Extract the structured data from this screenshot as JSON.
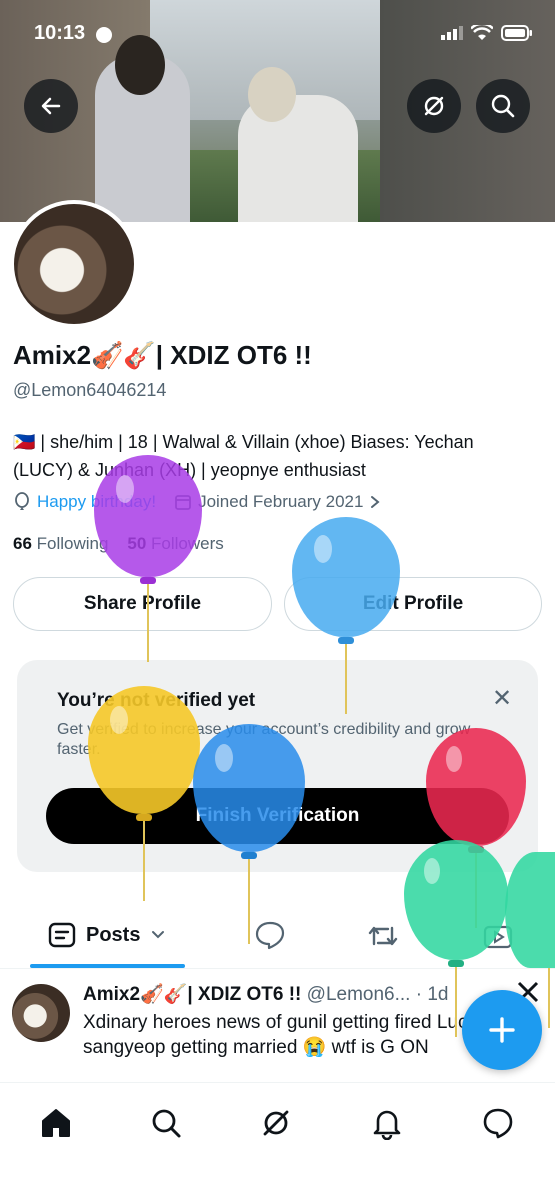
{
  "status": {
    "time": "10:13"
  },
  "profile": {
    "name": "Amix2🎻🎸| XDIZ OT6 !!",
    "handle": "@Lemon64046214",
    "bio": "🇵🇭 | she/him | 18 | Walwal & Villain (xhoe) Biases: Yechan (LUCY) & Junhan (XH) | yeopnye enthusiast",
    "birthday_label": "Happy birthday!",
    "joined": "Joined February 2021",
    "following_count": "66",
    "following_label": "Following",
    "followers_count": "50",
    "followers_label": "Followers"
  },
  "buttons": {
    "share": "Share Profile",
    "edit": "Edit Profile"
  },
  "verify": {
    "title": "You’re not verified yet",
    "subtitle": "Get verified to increase your account’s credibility and grow faster.",
    "button": "Finish Verification"
  },
  "tabs": {
    "posts": "Posts"
  },
  "tweet": {
    "name": "Amix2🎻🎸| XDIZ OT6 !!",
    "handle_time": "@Lemon6... · 1d",
    "body": "Xdinary heroes news of gunil getting fired Lucy sangyeop getting married 😭 wtf is G ON"
  },
  "colors": {
    "accent": "#1d9bf0",
    "text": "#0f1419",
    "muted": "#536471"
  },
  "icons": [
    "back-arrow-icon",
    "grok-icon",
    "search-icon",
    "birthday-balloon-icon",
    "calendar-icon",
    "chevron-right-icon",
    "close-icon",
    "posts-icon",
    "chevron-down-icon",
    "reply-icon",
    "repost-icon",
    "video-icon",
    "x-logo-icon",
    "plus-icon",
    "home-icon",
    "notifications-icon",
    "messages-icon"
  ]
}
